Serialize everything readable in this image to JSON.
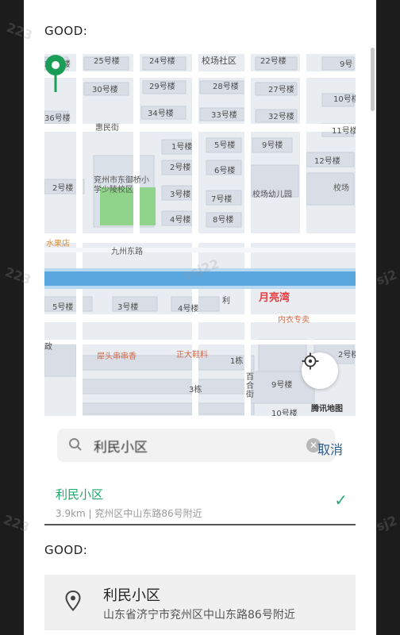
{
  "headings": {
    "top": "GOOD:",
    "bottom": "GOOD:"
  },
  "map": {
    "buildings": [
      "25号楼",
      "24号楼",
      "22号楼",
      "9号",
      "26号楼",
      "30号楼",
      "29号楼",
      "28号楼",
      "27号楼",
      "10号楼",
      "34号楼",
      "33号楼",
      "32号楼",
      "36号楼",
      "11号楼",
      "1号楼",
      "5号楼",
      "9号楼",
      "12号楼",
      "2号楼",
      "6号楼",
      "2号楼",
      "3号楼",
      "7号楼",
      "4号楼",
      "8号楼",
      "5号楼",
      "3号楼",
      "4号楼",
      "2号楼",
      "9号楼",
      "10号楼",
      "1栋",
      "3栋"
    ],
    "poi_school": "兖州市东御桥小学少陵校区",
    "poi_kindergarten": "校场幼儿园",
    "poi_community": "校场社区",
    "poi_xiaochang": "校场",
    "poi_fruit": "水果店",
    "road_main": "九州东路",
    "road_street": "惠民街",
    "poi_moon": "月亮湾",
    "poi_lingerie": "内衣专卖",
    "poi_restaurant": "犀头串串香",
    "poi_shoes": "正大鞋料",
    "poi_baihe": "百合街",
    "poi_li": "利",
    "poi_zheng": "政",
    "brand": "腾讯地图",
    "colors": {
      "water": "#5aa7e0",
      "park": "#8fd48a",
      "pin": "#1a9e57",
      "road": "#ffffff"
    }
  },
  "search": {
    "value": "利民小区",
    "cancel_label": "取消"
  },
  "result": {
    "title": "利民小区",
    "subtitle": "3.9km | 兖州区中山东路86号附近"
  },
  "address_card": {
    "title": "利民小区",
    "subtitle": "山东省济宁市兖州区中山东路86号附近"
  },
  "watermark": {
    "text_a": "223",
    "text_b": "ssj22",
    "text_c": "sj2"
  }
}
